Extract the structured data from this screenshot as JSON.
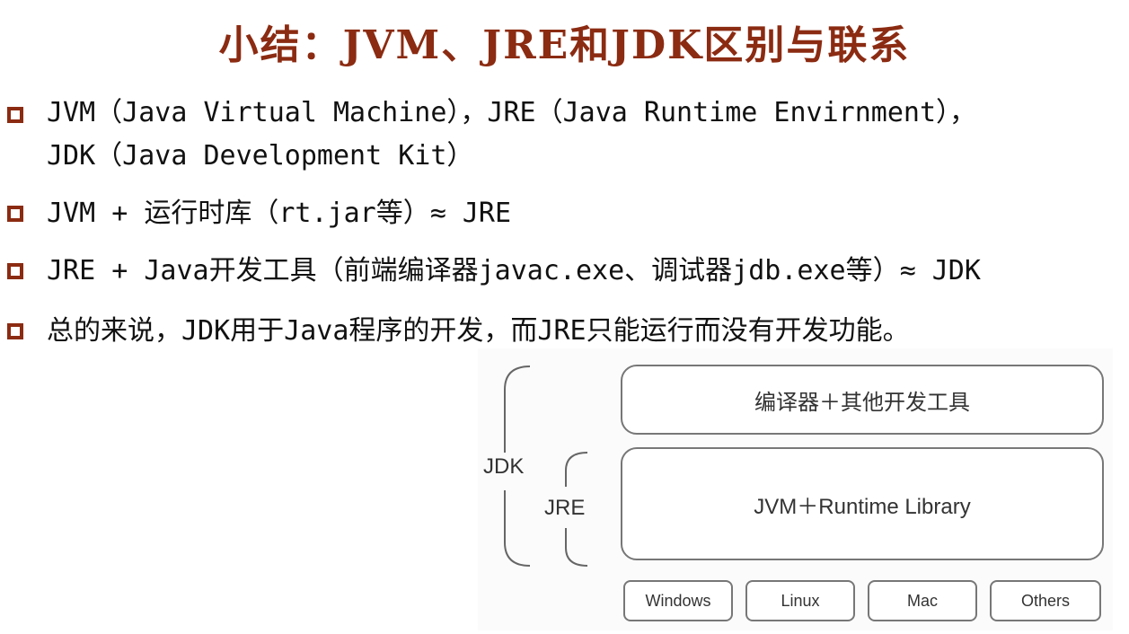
{
  "title": "小结：JVM、JRE和JDK区别与联系",
  "bullets": [
    {
      "line1": "JVM（Java Virtual Machine），JRE（Java Runtime Envirnment），",
      "line2": "JDK（Java Development Kit）"
    },
    {
      "line1": "JVM + 运行时库（rt.jar等）≈ JRE"
    },
    {
      "line1": "JRE + Java开发工具（前端编译器javac.exe、调试器jdb.exe等）≈ JDK"
    },
    {
      "line1": "总的来说，JDK用于Java程序的开发，而JRE只能运行而没有开发功能。"
    }
  ],
  "diagram": {
    "top_box": "编译器＋其他开发工具",
    "mid_box": "JVM＋Runtime Library",
    "jdk_label": "JDK",
    "jre_label": "JRE",
    "platforms": [
      "Windows",
      "Linux",
      "Mac",
      "Others"
    ]
  },
  "colors": {
    "title": "#8b2b12",
    "bullet_marker": "#8b2b12",
    "diagram_border": "#777777"
  }
}
